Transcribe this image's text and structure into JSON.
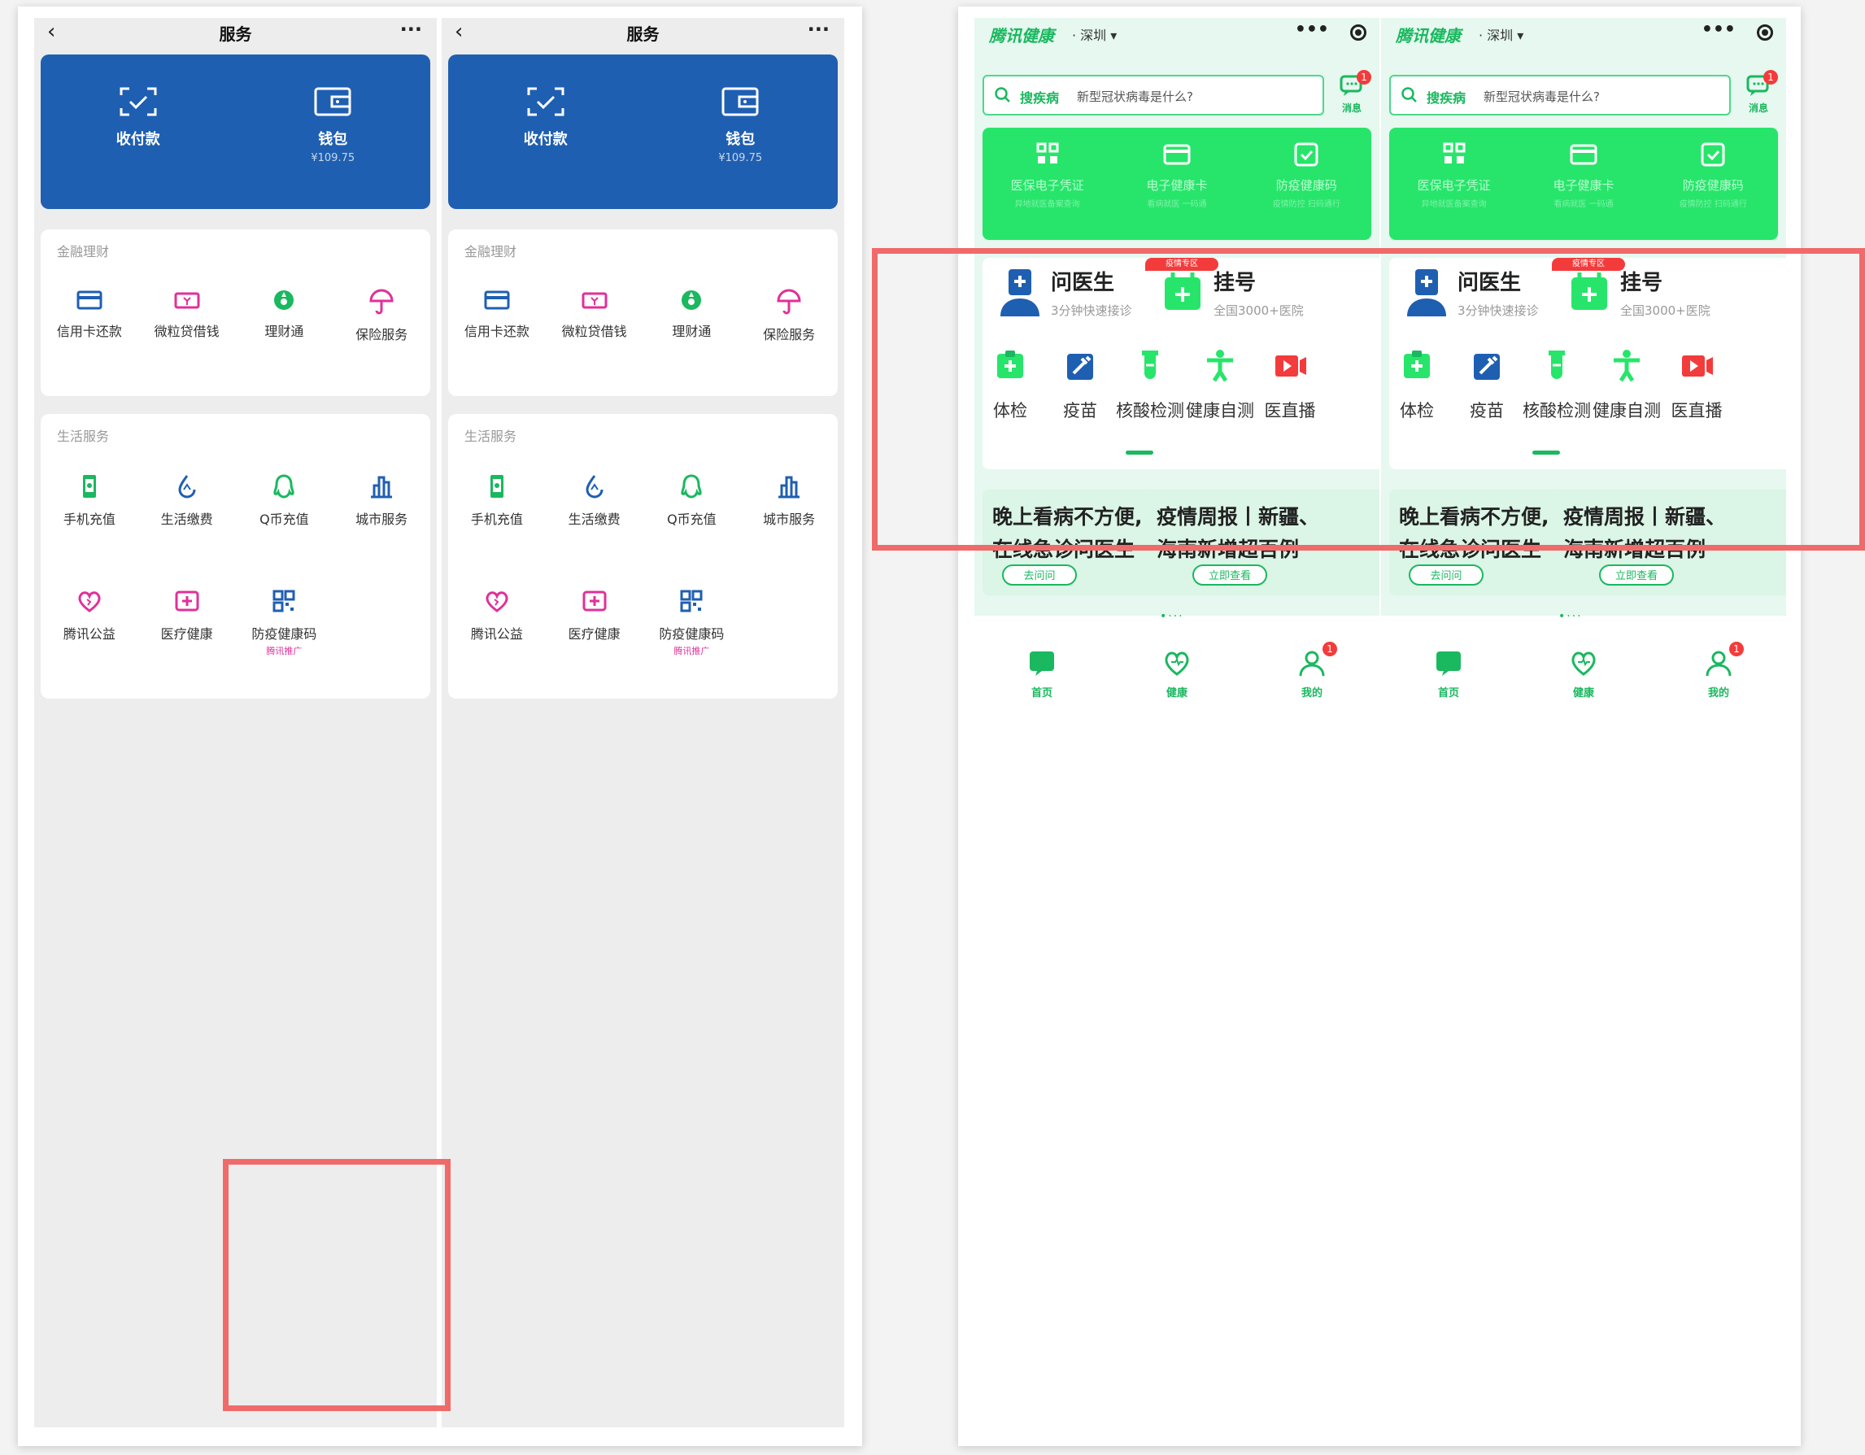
{
  "wechat": {
    "nav": {
      "back": "‹",
      "title": "服务",
      "more": "···"
    },
    "pay": {
      "label": "收付款",
      "icon": "scan-icon"
    },
    "wallet": {
      "label": "钱包",
      "balance": "¥109.75",
      "icon": "wallet-icon"
    },
    "finance": {
      "title": "金融理财",
      "items": [
        {
          "label": "信用卡还款",
          "icon": "credit-card-icon",
          "color": "#1f5fb1"
        },
        {
          "label": "微粒贷借钱",
          "icon": "loan-icon",
          "color": "#e0309a"
        },
        {
          "label": "理财通",
          "icon": "wealth-icon",
          "color": "#1ab85f"
        },
        {
          "label": "保险服务",
          "icon": "umbrella-icon",
          "color": "#e0309a"
        }
      ]
    },
    "life": {
      "title": "生活服务",
      "items": [
        {
          "label": "手机充值",
          "icon": "phone-icon",
          "color": "#1ab85f"
        },
        {
          "label": "生活缴费",
          "icon": "drop-icon",
          "color": "#1f5fb1"
        },
        {
          "label": "Q币充值",
          "icon": "qq-icon",
          "color": "#1ab85f"
        },
        {
          "label": "城市服务",
          "icon": "city-icon",
          "color": "#1f5fb1"
        },
        {
          "label": "腾讯公益",
          "icon": "heart-icon",
          "color": "#e0309a"
        },
        {
          "label": "医疗健康",
          "icon": "medical-icon",
          "color": "#e0309a"
        },
        {
          "label": "防疫健康码",
          "icon": "qrcode-icon",
          "color": "#1f5fb1",
          "tag": "腾讯推广"
        }
      ]
    }
  },
  "health": {
    "brand": "腾讯健康",
    "city": "· 深圳 ▾",
    "more": "•••",
    "search": {
      "keyword": "搜疾病",
      "placeholder": "新型冠状病毒是什么?"
    },
    "message": {
      "label": "消息",
      "badge": "1"
    },
    "cards": [
      {
        "label": "医保电子凭证",
        "sub": "异地就医备案查询",
        "icon": "medical-card-icon"
      },
      {
        "label": "电子健康卡",
        "sub": "看病就医 一码通",
        "icon": "health-card-icon"
      },
      {
        "label": "防疫健康码",
        "sub": "疫情防控 扫码通行",
        "icon": "shield-check-icon"
      }
    ],
    "doctor": {
      "title": "问医生",
      "sub": "3分钟快速接诊",
      "hot": "疫情专区"
    },
    "register": {
      "title": "挂号",
      "sub": "全国3000+医院"
    },
    "quick": [
      "体检",
      "疫苗",
      "核酸检测",
      "健康自测",
      "医直播"
    ],
    "news": [
      {
        "line1": "晚上看病不方便,",
        "line2": "在线急诊问医生",
        "btn": "去问问"
      },
      {
        "line1": "疫情周报丨新疆、",
        "line2": "海南新增超百例",
        "btn": "立即查看"
      }
    ],
    "pager": "•···",
    "tabs": [
      {
        "label": "首页",
        "icon": "home-icon",
        "badge": ""
      },
      {
        "label": "健康",
        "icon": "health-heart-icon",
        "badge": ""
      },
      {
        "label": "我的",
        "icon": "user-icon",
        "badge": "1"
      }
    ]
  },
  "colors": {
    "wechat_blue": "#1f5fb1",
    "health_green": "#1ab85f",
    "highlight": "#f06a6a"
  }
}
